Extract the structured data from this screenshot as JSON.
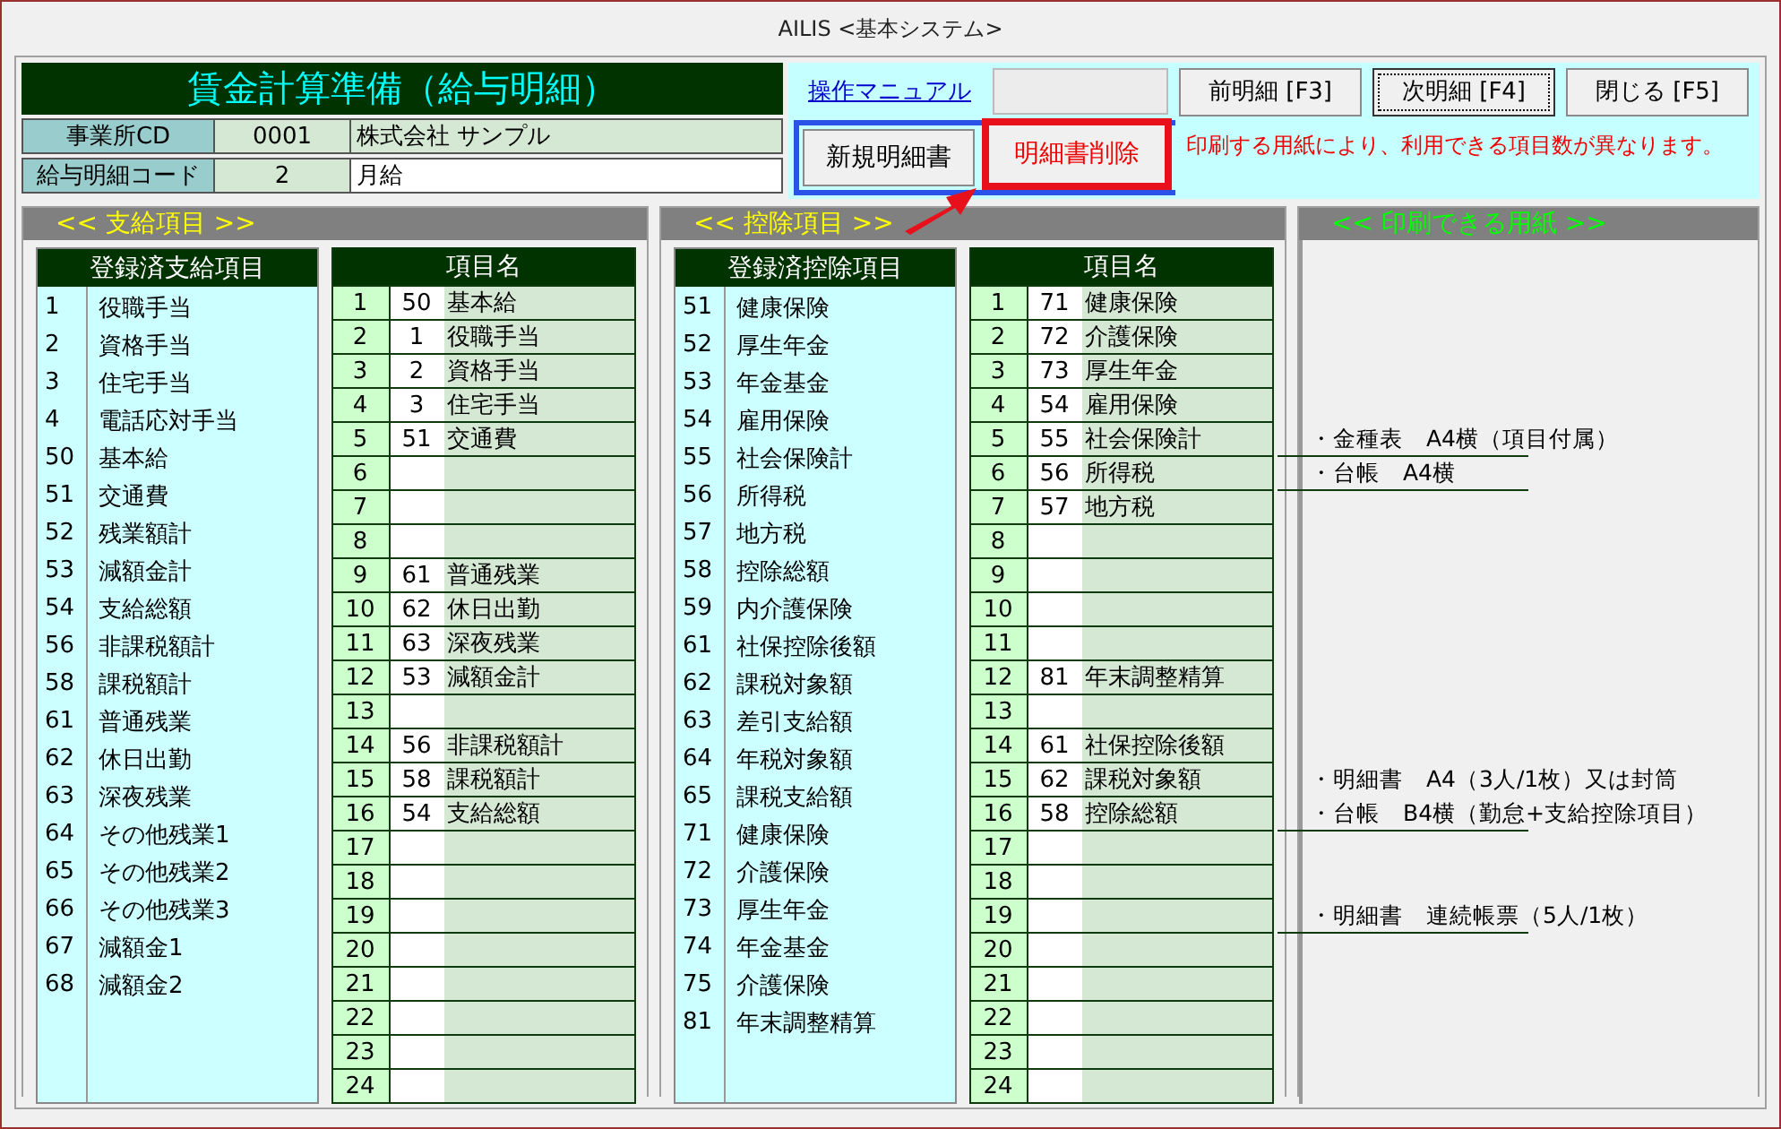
{
  "window": {
    "title": "AILIS <基本システム>"
  },
  "header": {
    "title": "賃金計算準備（給与明細）",
    "fields": [
      {
        "label": "事業所CD",
        "code": "0001",
        "value": "株式会社 サンプル",
        "editable": false
      },
      {
        "label": "給与明細コード",
        "code": "2",
        "value": "月給",
        "editable": true
      }
    ]
  },
  "toolbar": {
    "manual_link": "操作マニュアル",
    "buttons": [
      {
        "label": "前明細 [F3]",
        "selected": false
      },
      {
        "label": "次明細 [F4]",
        "selected": true
      },
      {
        "label": "閉じる [F5]",
        "selected": false
      }
    ],
    "actions": [
      {
        "label": "新規明細書",
        "kind": "normal"
      },
      {
        "label": "明細書削除",
        "kind": "danger"
      }
    ],
    "notice": "印刷する用紙により、利用できる項目数が異なります。"
  },
  "sections": [
    {
      "title": "<< 支給項目 >>",
      "registered": {
        "heading": "登録済支給項目",
        "items": [
          {
            "code": "1",
            "name": "役職手当"
          },
          {
            "code": "2",
            "name": "資格手当"
          },
          {
            "code": "3",
            "name": "住宅手当"
          },
          {
            "code": "4",
            "name": "電話応対手当"
          },
          {
            "code": "50",
            "name": "基本給"
          },
          {
            "code": "51",
            "name": "交通費"
          },
          {
            "code": "52",
            "name": "残業額計"
          },
          {
            "code": "53",
            "name": "減額金計"
          },
          {
            "code": "54",
            "name": "支給総額"
          },
          {
            "code": "56",
            "name": "非課税額計"
          },
          {
            "code": "58",
            "name": "課税額計"
          },
          {
            "code": "61",
            "name": "普通残業"
          },
          {
            "code": "62",
            "name": "休日出勤"
          },
          {
            "code": "63",
            "name": "深夜残業"
          },
          {
            "code": "64",
            "name": "その他残業1"
          },
          {
            "code": "65",
            "name": "その他残業2"
          },
          {
            "code": "66",
            "name": "その他残業3"
          },
          {
            "code": "67",
            "name": "減額金1"
          },
          {
            "code": "68",
            "name": "減額金2"
          }
        ]
      },
      "assigned": {
        "heading": "項目名",
        "rows": [
          {
            "no": "1",
            "code": "50",
            "name": "基本給"
          },
          {
            "no": "2",
            "code": "1",
            "name": "役職手当"
          },
          {
            "no": "3",
            "code": "2",
            "name": "資格手当"
          },
          {
            "no": "4",
            "code": "3",
            "name": "住宅手当"
          },
          {
            "no": "5",
            "code": "51",
            "name": "交通費"
          },
          {
            "no": "6"
          },
          {
            "no": "7"
          },
          {
            "no": "8"
          },
          {
            "no": "9",
            "code": "61",
            "name": "普通残業"
          },
          {
            "no": "10",
            "code": "62",
            "name": "休日出勤"
          },
          {
            "no": "11",
            "code": "63",
            "name": "深夜残業"
          },
          {
            "no": "12",
            "code": "53",
            "name": "減額金計"
          },
          {
            "no": "13"
          },
          {
            "no": "14",
            "code": "56",
            "name": "非課税額計"
          },
          {
            "no": "15",
            "code": "58",
            "name": "課税額計"
          },
          {
            "no": "16",
            "code": "54",
            "name": "支給総額"
          },
          {
            "no": "17"
          },
          {
            "no": "18"
          },
          {
            "no": "19"
          },
          {
            "no": "20"
          },
          {
            "no": "21"
          },
          {
            "no": "22"
          },
          {
            "no": "23"
          },
          {
            "no": "24"
          }
        ]
      }
    },
    {
      "title": "<< 控除項目 >>",
      "registered": {
        "heading": "登録済控除項目",
        "items": [
          {
            "code": "51",
            "name": "健康保険"
          },
          {
            "code": "52",
            "name": "厚生年金"
          },
          {
            "code": "53",
            "name": "年金基金"
          },
          {
            "code": "54",
            "name": "雇用保険"
          },
          {
            "code": "55",
            "name": "社会保険計"
          },
          {
            "code": "56",
            "name": "所得税"
          },
          {
            "code": "57",
            "name": "地方税"
          },
          {
            "code": "58",
            "name": "控除総額"
          },
          {
            "code": "59",
            "name": "内介護保険"
          },
          {
            "code": "61",
            "name": "社保控除後額"
          },
          {
            "code": "62",
            "name": "課税対象額"
          },
          {
            "code": "63",
            "name": "差引支給額"
          },
          {
            "code": "64",
            "name": "年税対象額"
          },
          {
            "code": "65",
            "name": "課税支給額"
          },
          {
            "code": "71",
            "name": "健康保険"
          },
          {
            "code": "72",
            "name": "介護保険"
          },
          {
            "code": "73",
            "name": "厚生年金"
          },
          {
            "code": "74",
            "name": "年金基金"
          },
          {
            "code": "75",
            "name": "介護保険"
          },
          {
            "code": "81",
            "name": "年末調整精算"
          }
        ]
      },
      "assigned": {
        "heading": "項目名",
        "rows": [
          {
            "no": "1",
            "code": "71",
            "name": "健康保険"
          },
          {
            "no": "2",
            "code": "72",
            "name": "介護保険"
          },
          {
            "no": "3",
            "code": "73",
            "name": "厚生年金"
          },
          {
            "no": "4",
            "code": "54",
            "name": "雇用保険"
          },
          {
            "no": "5",
            "code": "55",
            "name": "社会保険計"
          },
          {
            "no": "6",
            "code": "56",
            "name": "所得税"
          },
          {
            "no": "7",
            "code": "57",
            "name": "地方税"
          },
          {
            "no": "8"
          },
          {
            "no": "9"
          },
          {
            "no": "10"
          },
          {
            "no": "11"
          },
          {
            "no": "12",
            "code": "81",
            "name": "年末調整精算"
          },
          {
            "no": "13"
          },
          {
            "no": "14",
            "code": "61",
            "name": "社保控除後額"
          },
          {
            "no": "15",
            "code": "62",
            "name": "課税対象額"
          },
          {
            "no": "16",
            "code": "58",
            "name": "控除総額"
          },
          {
            "no": "17"
          },
          {
            "no": "18"
          },
          {
            "no": "19"
          },
          {
            "no": "20"
          },
          {
            "no": "21"
          },
          {
            "no": "22"
          },
          {
            "no": "23"
          },
          {
            "no": "24"
          }
        ]
      }
    }
  ],
  "paper": {
    "title": "<< 印刷できる用紙 >>",
    "rows": [
      {
        "boundary": false
      },
      {
        "boundary": false
      },
      {
        "boundary": false
      },
      {
        "boundary": false
      },
      {
        "text": "・金種表　A4横（項目付属）",
        "boundary": true
      },
      {
        "text": "・台帳　A4横",
        "boundary": true
      },
      {
        "boundary": false
      },
      {
        "boundary": false
      },
      {
        "boundary": false
      },
      {
        "boundary": false
      },
      {
        "boundary": false
      },
      {
        "boundary": false
      },
      {
        "boundary": false
      },
      {
        "boundary": false
      },
      {
        "text": "・明細書　A4（3人/1枚）又は封筒",
        "boundary": false
      },
      {
        "text": "・台帳　B4横（勤怠+支給控除項目）",
        "boundary": true
      },
      {
        "boundary": false
      },
      {
        "boundary": false
      },
      {
        "text": "・明細書　連続帳票（5人/1枚）",
        "boundary": true
      },
      {
        "boundary": false
      },
      {
        "boundary": false
      },
      {
        "boundary": false
      },
      {
        "boundary": false
      },
      {
        "boundary": false
      }
    ]
  }
}
